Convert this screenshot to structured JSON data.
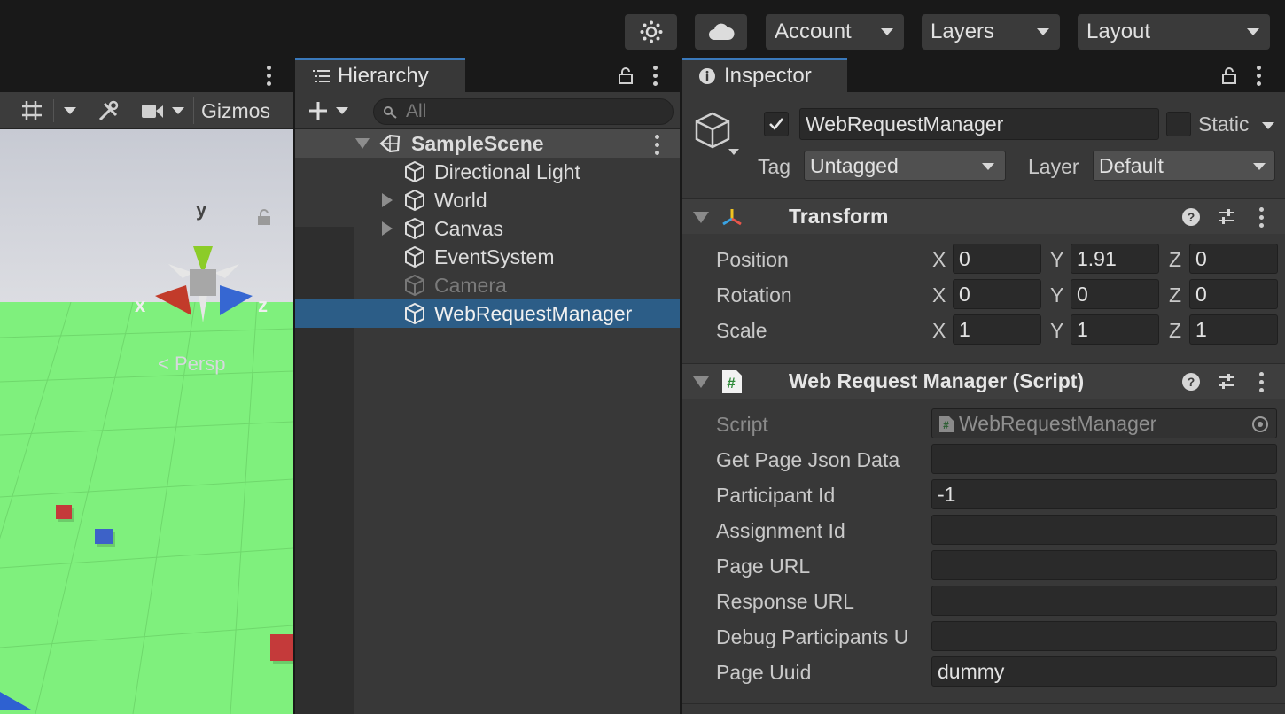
{
  "toolbar": {
    "account_label": "Account",
    "layers_label": "Layers",
    "layout_label": "Layout"
  },
  "scene": {
    "gizmos_label": "Gizmos",
    "axis_y": "y",
    "axis_x": "x",
    "axis_z": "z",
    "persp_label": "< Persp"
  },
  "hierarchy": {
    "tab_label": "Hierarchy",
    "search_placeholder": "All",
    "scene_name": "SampleScene",
    "items": [
      {
        "label": "Directional Light"
      },
      {
        "label": "World"
      },
      {
        "label": "Canvas"
      },
      {
        "label": "EventSystem"
      },
      {
        "label": "Camera"
      },
      {
        "label": "WebRequestManager"
      }
    ]
  },
  "inspector": {
    "tab_label": "Inspector",
    "object_name": "WebRequestManager",
    "static_label": "Static",
    "tag_label": "Tag",
    "tag_value": "Untagged",
    "layer_label": "Layer",
    "layer_value": "Default",
    "transform": {
      "title": "Transform",
      "rows": [
        {
          "label": "Position",
          "x": "0",
          "y": "1.91",
          "z": "0"
        },
        {
          "label": "Rotation",
          "x": "0",
          "y": "0",
          "z": "0"
        },
        {
          "label": "Scale",
          "x": "1",
          "y": "1",
          "z": "1"
        }
      ],
      "axis_x": "X",
      "axis_y": "Y",
      "axis_z": "Z"
    },
    "script_component": {
      "title": "Web Request Manager (Script)",
      "script_label": "Script",
      "script_value": "WebRequestManager",
      "fields": [
        {
          "label": "Get Page Json Data",
          "value": ""
        },
        {
          "label": "Participant Id",
          "value": "-1"
        },
        {
          "label": "Assignment Id",
          "value": ""
        },
        {
          "label": "Page URL",
          "value": ""
        },
        {
          "label": "Response URL",
          "value": ""
        },
        {
          "label": "Debug Participants U",
          "value": ""
        },
        {
          "label": "Page Uuid",
          "value": "dummy"
        }
      ]
    }
  }
}
